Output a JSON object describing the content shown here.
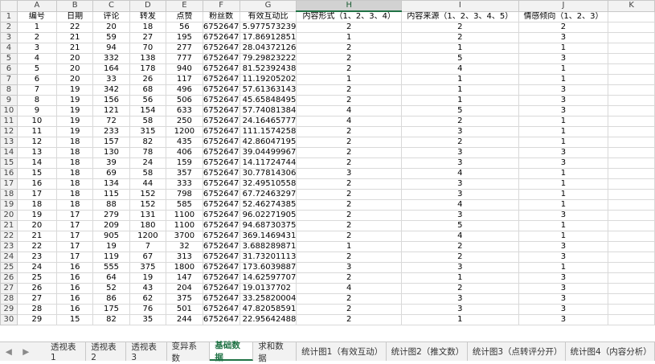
{
  "columns": [
    "A",
    "B",
    "C",
    "D",
    "E",
    "F",
    "G",
    "H",
    "I",
    "J",
    "K"
  ],
  "selected_column": "H",
  "header_row": [
    "编号",
    "日期",
    "评论",
    "转发",
    "点赞",
    "粉丝数",
    "有效互动比",
    "内容形式（1、2、3、4）",
    "内容来源（1、2、3、4、5）",
    "情感倾向（1、2、3）",
    ""
  ],
  "rows": [
    [
      "1",
      "22",
      "20",
      "18",
      "56",
      "6752647",
      "5.977573239",
      "2",
      "2",
      "2"
    ],
    [
      "2",
      "21",
      "59",
      "27",
      "195",
      "6752647",
      "17.86912851",
      "1",
      "2",
      "3"
    ],
    [
      "3",
      "21",
      "94",
      "70",
      "277",
      "6752647",
      "28.04372126",
      "2",
      "1",
      "1"
    ],
    [
      "4",
      "20",
      "332",
      "138",
      "777",
      "6752647",
      "79.29823222",
      "2",
      "5",
      "3"
    ],
    [
      "5",
      "20",
      "164",
      "178",
      "940",
      "6752647",
      "81.52392438",
      "2",
      "4",
      "1"
    ],
    [
      "6",
      "20",
      "33",
      "26",
      "117",
      "6752647",
      "11.19205202",
      "1",
      "1",
      "1"
    ],
    [
      "7",
      "19",
      "342",
      "68",
      "496",
      "6752647",
      "57.61363143",
      "2",
      "1",
      "3"
    ],
    [
      "8",
      "19",
      "156",
      "56",
      "506",
      "6752647",
      "45.65848495",
      "2",
      "1",
      "3"
    ],
    [
      "9",
      "19",
      "121",
      "154",
      "633",
      "6752647",
      "57.74081384",
      "4",
      "5",
      "3"
    ],
    [
      "10",
      "19",
      "72",
      "58",
      "250",
      "6752647",
      "24.16465777",
      "4",
      "2",
      "1"
    ],
    [
      "11",
      "19",
      "233",
      "315",
      "1200",
      "6752647",
      "111.1574258",
      "2",
      "3",
      "1"
    ],
    [
      "12",
      "18",
      "157",
      "82",
      "435",
      "6752647",
      "42.86047195",
      "2",
      "2",
      "1"
    ],
    [
      "13",
      "18",
      "130",
      "78",
      "406",
      "6752647",
      "39.04499967",
      "2",
      "3",
      "3"
    ],
    [
      "14",
      "18",
      "39",
      "24",
      "159",
      "6752647",
      "14.11724744",
      "2",
      "3",
      "3"
    ],
    [
      "15",
      "18",
      "69",
      "58",
      "357",
      "6752647",
      "30.77814306",
      "3",
      "4",
      "1"
    ],
    [
      "16",
      "18",
      "134",
      "44",
      "333",
      "6752647",
      "32.49510558",
      "2",
      "3",
      "1"
    ],
    [
      "17",
      "18",
      "115",
      "152",
      "798",
      "6752647",
      "67.72463297",
      "2",
      "3",
      "1"
    ],
    [
      "18",
      "18",
      "88",
      "152",
      "585",
      "6752647",
      "52.46274385",
      "2",
      "4",
      "1"
    ],
    [
      "19",
      "17",
      "279",
      "131",
      "1100",
      "6752647",
      "96.02271905",
      "2",
      "3",
      "3"
    ],
    [
      "20",
      "17",
      "209",
      "180",
      "1100",
      "6752647",
      "94.68730375",
      "2",
      "5",
      "1"
    ],
    [
      "21",
      "17",
      "905",
      "1200",
      "3700",
      "6752647",
      "369.1469431",
      "2",
      "4",
      "1"
    ],
    [
      "22",
      "17",
      "19",
      "7",
      "32",
      "6752647",
      "3.688289871",
      "1",
      "2",
      "3"
    ],
    [
      "23",
      "17",
      "119",
      "67",
      "313",
      "6752647",
      "31.73201113",
      "2",
      "2",
      "3"
    ],
    [
      "24",
      "16",
      "555",
      "375",
      "1800",
      "6752647",
      "173.6039887",
      "3",
      "3",
      "1"
    ],
    [
      "25",
      "16",
      "64",
      "19",
      "147",
      "6752647",
      "14.62597707",
      "2",
      "1",
      "3"
    ],
    [
      "26",
      "16",
      "52",
      "43",
      "204",
      "6752647",
      "19.0137702",
      "4",
      "2",
      "3"
    ],
    [
      "27",
      "16",
      "86",
      "62",
      "375",
      "6752647",
      "33.25820004",
      "2",
      "3",
      "3"
    ],
    [
      "28",
      "16",
      "175",
      "76",
      "501",
      "6752647",
      "47.82058591",
      "2",
      "3",
      "3"
    ],
    [
      "29",
      "15",
      "82",
      "35",
      "244",
      "6752647",
      "22.95642488",
      "2",
      "1",
      "3"
    ]
  ],
  "sheet_tabs": [
    "透视表1",
    "透视表2",
    "透视表3",
    "变异系数",
    "基础数据",
    "求和数据",
    "统计图1（有效互动）",
    "统计图2（推文数）",
    "统计图3（点转评分开）",
    "统计图4（内容分析）"
  ],
  "active_tab": "基础数据",
  "nav": {
    "prev": "◀",
    "next": "▶"
  }
}
